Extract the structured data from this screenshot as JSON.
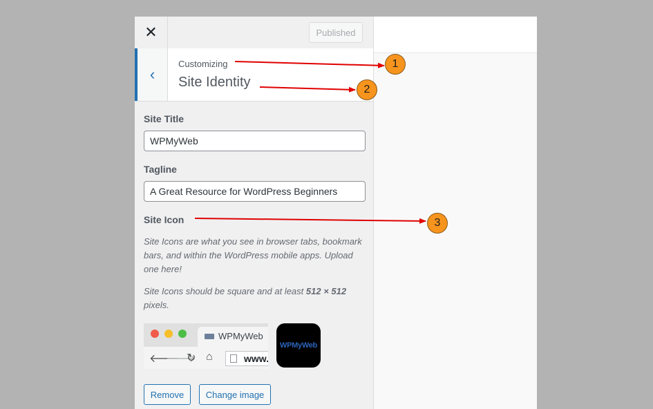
{
  "toolbar": {
    "close_icon": "close-icon",
    "published_label": "Published"
  },
  "section": {
    "back_icon": "chevron-left-icon",
    "breadcrumb": "Customizing",
    "title": "Site Identity"
  },
  "fields": {
    "site_title": {
      "label": "Site Title",
      "value": "WPMyWeb"
    },
    "tagline": {
      "label": "Tagline",
      "value": "A Great Resource for WordPress Beginners"
    }
  },
  "site_icon": {
    "label": "Site Icon",
    "description": "Site Icons are what you see in browser tabs, bookmark bars, and within the WordPress mobile apps. Upload one here!",
    "size_note_prefix": "Site Icons should be square and at least ",
    "size_note_value": "512 × 512",
    "size_note_suffix": " pixels.",
    "browser_preview": {
      "tab_title": "WPMyWeb",
      "url_text": "www."
    },
    "app_icon_text": "WPMyWeb",
    "remove_label": "Remove",
    "change_label": "Change image"
  },
  "annotations": [
    "1",
    "2",
    "3"
  ],
  "colors": {
    "accent": "#2271b1",
    "annotation_badge": "#f7941d",
    "annotation_arrow": "#e00000"
  }
}
